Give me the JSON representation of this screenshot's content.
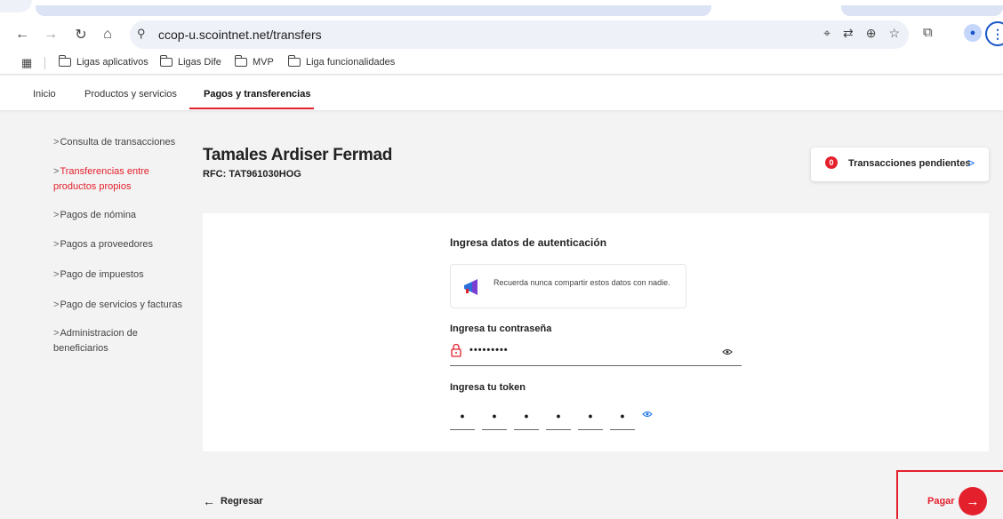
{
  "browser": {
    "url": "ccop-u.scointnet.net/transfers",
    "bookmarks": [
      "Ligas aplicativos",
      "Ligas Dife",
      "MVP",
      "Liga funcionalidades"
    ]
  },
  "appnav": {
    "items": [
      "Inicio",
      "Productos y servicios",
      "Pagos y transferencias"
    ],
    "active_index": 2
  },
  "sidebar": {
    "items": [
      {
        "prefix": ">",
        "label": "Consulta de transacciones"
      },
      {
        "prefix": ">",
        "label": "Transferencias entre productos propios",
        "active": true
      },
      {
        "prefix": ">",
        "label": "Pagos de nómina"
      },
      {
        "prefix": ">",
        "label": "Pagos a proveedores"
      },
      {
        "prefix": ">",
        "label": "Pago de impuestos"
      },
      {
        "prefix": ">",
        "label": "Pago de servicios y facturas"
      },
      {
        "prefix": ">",
        "label": "Administracion de beneficiarios"
      }
    ]
  },
  "customer": {
    "name": "Tamales Ardiser Fermad",
    "rfc": "RFC: TAT961030HOG"
  },
  "pending": {
    "count": "0",
    "label": "Transacciones pendientes",
    "chevron": ">"
  },
  "auth": {
    "title": "Ingresa datos de autenticación",
    "notice": "Recuerda nunca compartir estos datos con nadie.",
    "password_label": "Ingresa tu contraseña",
    "password_value": "•••••••••",
    "token_label": "Ingresa tu token",
    "token_digits": [
      "•",
      "•",
      "•",
      "•",
      "•",
      "•"
    ]
  },
  "actions": {
    "back_label": "Regresar",
    "back_arrow": "←",
    "pay_label": "Pagar",
    "pay_arrow": "→"
  },
  "colors": {
    "accent": "#e4202c",
    "link_blue": "#1a73e8"
  }
}
